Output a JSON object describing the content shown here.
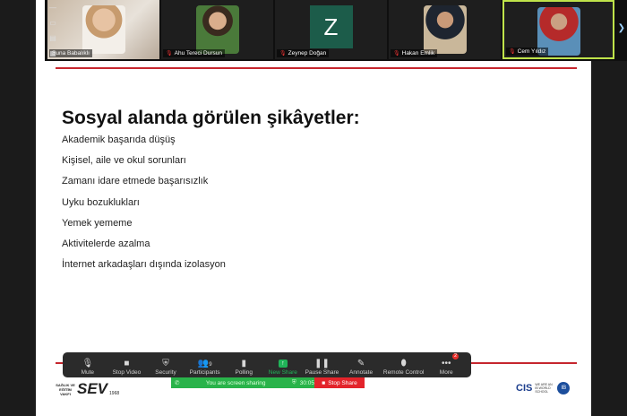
{
  "participants": [
    {
      "name": "Suna Babalıklı",
      "muted": false
    },
    {
      "name": "Ahu Tereci Dursun",
      "muted": true
    },
    {
      "name": "Zeynep Doğan",
      "muted": true,
      "initial": "Z"
    },
    {
      "name": "Hakan Emlik",
      "muted": true
    },
    {
      "name": "Cem Yıldız",
      "muted": true
    }
  ],
  "slide": {
    "title": "Sosyal alanda görülen şikâyetler:",
    "bullets": [
      "Akademik başarıda düşüş",
      "Kişisel, aile ve okul sorunları",
      "Zamanı idare etmede başarısızlık",
      "Uyku bozuklukları",
      "Yemek yememe",
      "Aktivitelerde azalma",
      "İnternet arkadaşları dışında izolasyon"
    ]
  },
  "toolbar": {
    "mute": "Mute",
    "stop_video": "Stop Video",
    "security": "Security",
    "participants": "Participants",
    "participants_count": "9",
    "polling": "Polling",
    "new_share": "New Share",
    "pause_share": "Pause Share",
    "annotate": "Annotate",
    "remote_control": "Remote Control",
    "more": "More",
    "more_badge": "2"
  },
  "share_bar": {
    "status": "You are screen sharing",
    "timer": "30:05",
    "stop": "Stop Share"
  },
  "logos": {
    "sev_tag": "SAĞLIK VE EĞİTİM VAKFI",
    "sev_name": "SEV",
    "sev_year": "1968",
    "cis_name": "CIS",
    "cis_tag": "WE ARE AN IB WORLD SCHOOL",
    "ib": "IB"
  },
  "colors": {
    "accent_red": "#c6262e",
    "share_green": "#29b34a",
    "stop_red": "#e3242b",
    "active_speaker_border": "#bfe34a"
  }
}
